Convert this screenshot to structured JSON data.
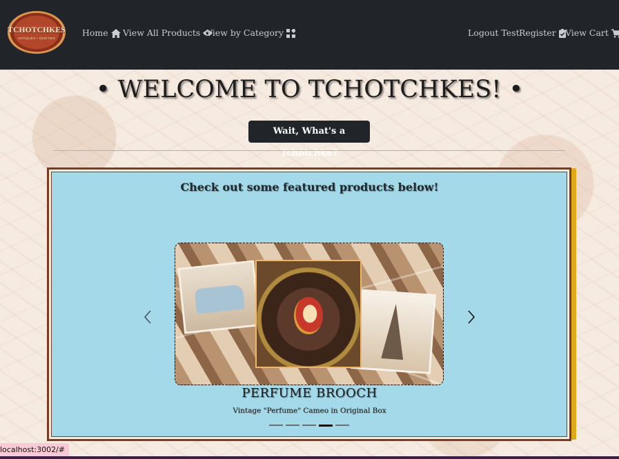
{
  "navbar": {
    "logo_text": "TCHOTCHKES",
    "logo_subtext": "ANTIQUES • ODDITIES",
    "left_links": [
      {
        "label": "Home",
        "icon": "home-icon"
      },
      {
        "label": "View All Products",
        "icon": "eye-icon"
      },
      {
        "label": "View by Category",
        "icon": "categories-icon"
      }
    ],
    "right_links": [
      {
        "label": "Logout Test"
      },
      {
        "label": "Register",
        "icon": "clipboard-check-icon"
      },
      {
        "label": "View Cart",
        "icon": "cart-icon"
      }
    ]
  },
  "header": {
    "welcome": "• WELCOME TO TCHOTCHKES! •",
    "what_button": "Wait, What's a Tchotchke?"
  },
  "featured": {
    "title": "Check out some featured products below!",
    "carousel": {
      "product_name": "PERFUME BROOCH",
      "product_description": "Vintage \"Perfume\" Cameo in Original Box",
      "indicator_count": 5,
      "active_index": 3
    }
  },
  "colors": {
    "navbar": "#212529",
    "featured_bg": "#a4d9e9",
    "frame": "#7a3b22",
    "accent_shadow": "#e0a915"
  },
  "status_bar": {
    "url": "localhost:3002/#"
  }
}
